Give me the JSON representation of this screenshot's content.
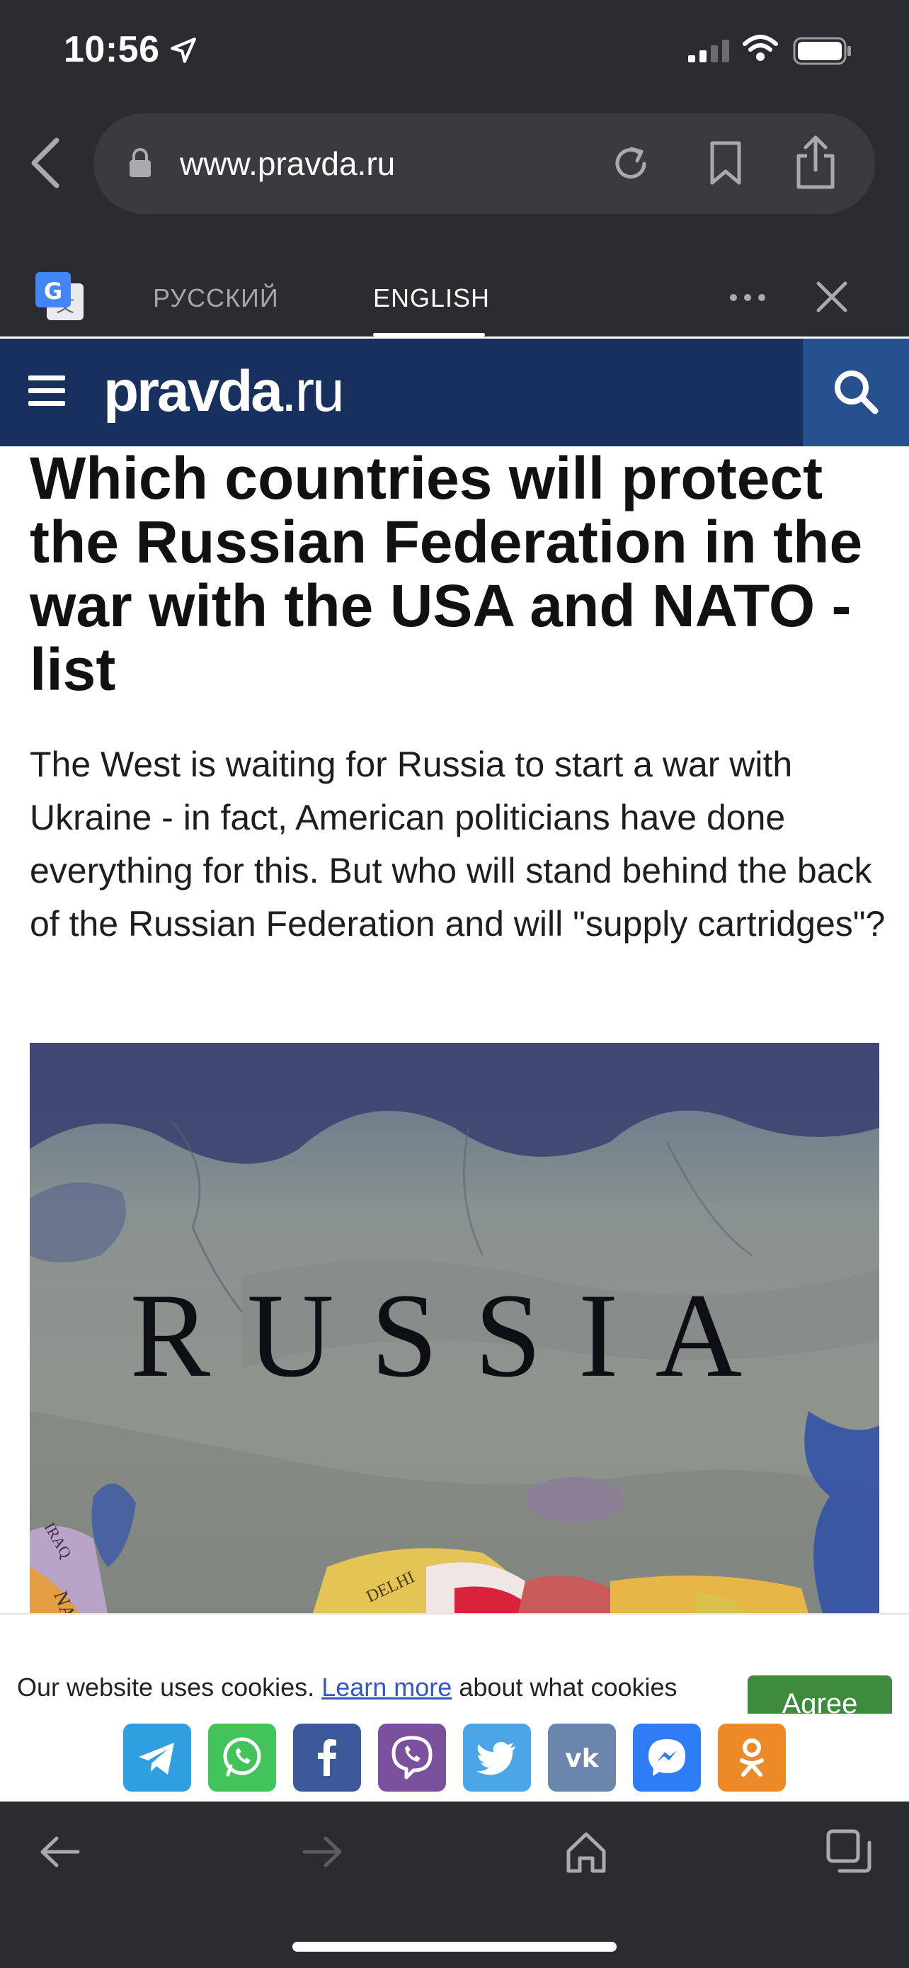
{
  "status_bar": {
    "time": "10:56"
  },
  "browser": {
    "url": "www.pravda.ru"
  },
  "translate_bar": {
    "tab_russian": "РУССКИЙ",
    "tab_english": "ENGLISH",
    "active_tab": "ENGLISH"
  },
  "site": {
    "logo_name": "pravda",
    "logo_tld": ".ru"
  },
  "article": {
    "title": "Which countries will protect the Russian Federation in the war with the USA and NATO - list",
    "lede": "The West is waiting for Russia to start a war with Ukraine - in fact, American politicians have done everything for this. But who will stand behind the back of the Russian Federation and will \"supply cartridges\"?",
    "image_map_label": "RUSSIA",
    "image_small_labels": [
      "IRAQ",
      "NA",
      "DELHI"
    ]
  },
  "cookie": {
    "text_before": "Our website uses cookies. ",
    "link": "Learn more",
    "text_after": " about what cookies",
    "agree_label": "Agree"
  },
  "share_buttons": [
    {
      "name": "telegram-icon",
      "color": "#2f9fe0"
    },
    {
      "name": "whatsapp-icon",
      "color": "#43c45a"
    },
    {
      "name": "facebook-icon",
      "color": "#3b5998"
    },
    {
      "name": "viber-icon",
      "color": "#7b519d"
    },
    {
      "name": "twitter-icon",
      "color": "#4ba6e8"
    },
    {
      "name": "vk-icon",
      "color": "#6a86ad"
    },
    {
      "name": "messenger-icon",
      "color": "#2e7cf6"
    },
    {
      "name": "odnoklassniki-icon",
      "color": "#ec8a27"
    }
  ],
  "colors": {
    "chrome": "#2b2c30",
    "site_header": "#17305e",
    "search_button": "#27508f",
    "agree_button": "#3e8b3e"
  }
}
